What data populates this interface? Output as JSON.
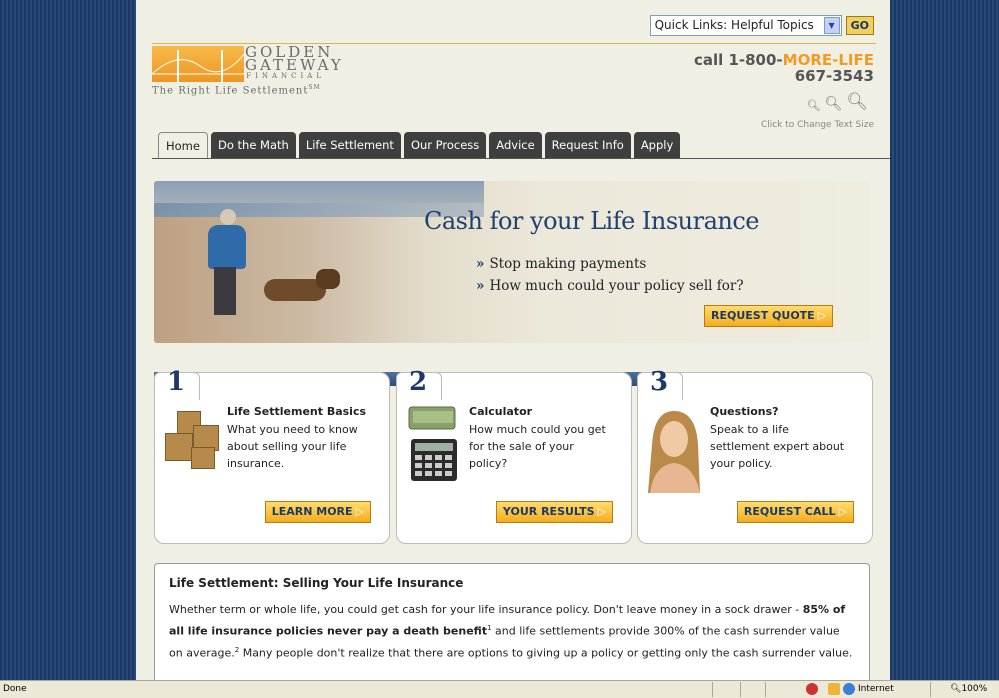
{
  "quick_links": {
    "label": "Quick Links: Helpful Topics",
    "go": "GO"
  },
  "logo": {
    "line1": "GOLDEN",
    "line2": "GATEWAY",
    "line3": "FINANCIAL",
    "tagline": "The Right Life Settlement",
    "tm": "SM"
  },
  "phone": {
    "prefix": "call 1-800-",
    "accent": "MORE-LIFE",
    "number": "667-3543"
  },
  "text_size": {
    "label": "Click to Change Text Size"
  },
  "tabs": [
    {
      "label": "Home"
    },
    {
      "label": "Do the Math"
    },
    {
      "label": "Life Settlement"
    },
    {
      "label": "Our Process"
    },
    {
      "label": "Advice"
    },
    {
      "label": "Request Info"
    },
    {
      "label": "Apply"
    }
  ],
  "hero": {
    "title": "Cash for your Life Insurance",
    "bullet1": "Stop making payments",
    "bullet2": "How much could your policy sell for?",
    "button": "REQUEST QUOTE"
  },
  "cards": [
    {
      "num": "1",
      "title": "Life Settlement Basics",
      "desc": "What you need to know about selling your life insurance.",
      "button": "LEARN MORE"
    },
    {
      "num": "2",
      "title": "Calculator",
      "desc": "How much could you get for the sale of your policy?",
      "button": "YOUR RESULTS"
    },
    {
      "num": "3",
      "title": "Questions?",
      "desc": "Speak to a life settlement expert about your policy.",
      "button": "REQUEST CALL"
    }
  ],
  "about": {
    "heading": "Life Settlement: Selling Your Life Insurance",
    "p_start": "Whether term or whole life, you could get cash for your life insurance policy. Don't leave money in a sock drawer - ",
    "p_bold": "85% of all life insurance policies never pay a death benefit",
    "p_sup1": "1",
    "p_mid": " and life settlements provide 300% of the cash surrender value on average.",
    "p_sup2": "2",
    "p_end": " Many people don't realize that there are options to giving up a policy or getting only the cash surrender value."
  },
  "status": {
    "left": "Done",
    "zone": "Internet",
    "zoom": "100%"
  },
  "colors": {
    "accent": "#f29a21",
    "navy": "#1d3a66",
    "page_bg": "#efefe3"
  }
}
